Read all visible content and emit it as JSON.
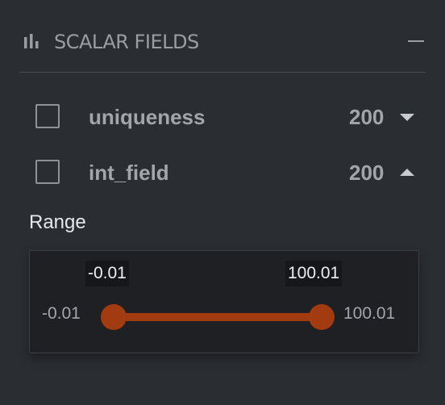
{
  "header": {
    "title": "SCALAR FIELDS",
    "icon": "bar-chart-icon",
    "collapse_icon": "minus-icon"
  },
  "fields": [
    {
      "name": "uniqueness",
      "count": "200",
      "expanded": false,
      "checked": false,
      "toggle_icon": "caret-down-icon"
    },
    {
      "name": "int_field",
      "count": "200",
      "expanded": true,
      "checked": false,
      "toggle_icon": "caret-up-icon"
    }
  ],
  "range": {
    "label": "Range",
    "min_bound": "-0.01",
    "max_bound": "100.01",
    "selected_min": "-0.01",
    "selected_max": "100.01"
  },
  "colors": {
    "background": "#2a2d32",
    "accent": "#a23b0f",
    "text_muted": "#a2a5aa",
    "text_light": "#e6e8ea"
  }
}
